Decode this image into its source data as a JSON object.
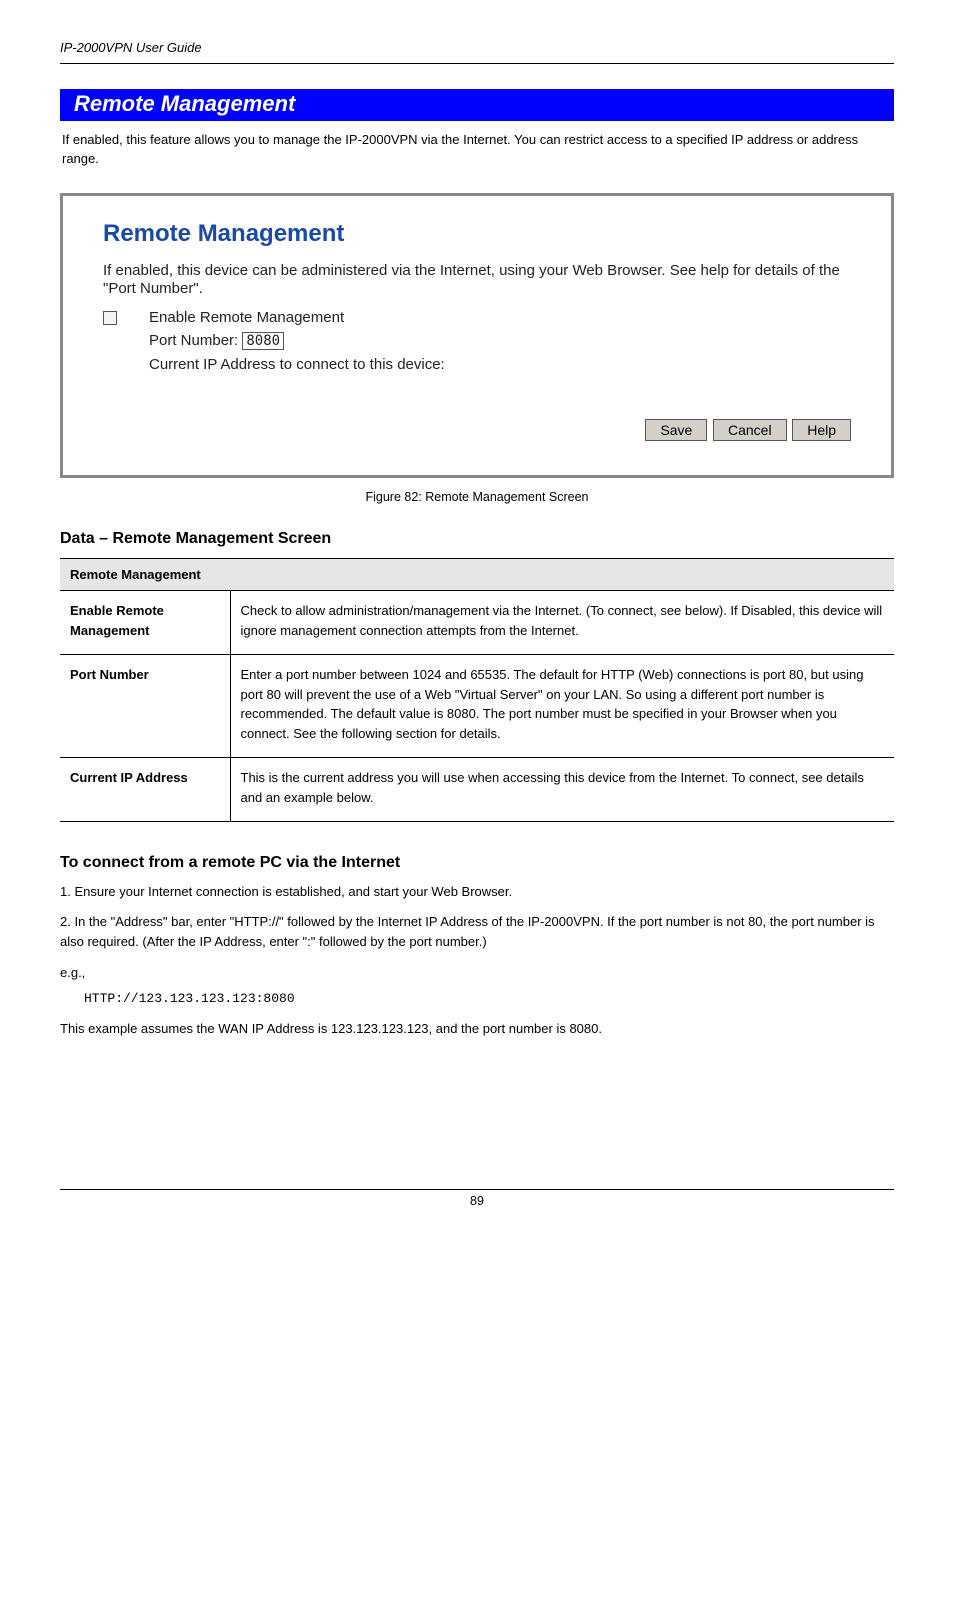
{
  "header": {
    "left": "IP-2000VPN User Guide",
    "right": ""
  },
  "bluebar": {
    "title": "Remote Management"
  },
  "intro": "If enabled, this feature allows you to manage the IP-2000VPN via the Internet. You can restrict access to a specified IP address or address range.",
  "screenshot": {
    "title": "Remote Management",
    "desc": "If enabled, this device can be administered via the Internet, using your Web Browser. See help for details of the \"Port Number\".",
    "checkbox_label": "Enable Remote Management",
    "port_label": "Port Number:",
    "port_value": "8080",
    "ip_label": "Current IP Address to connect to this device:",
    "buttons": {
      "save": "Save",
      "cancel": "Cancel",
      "help": "Help"
    }
  },
  "caption": "Figure 82: Remote Management Screen",
  "data_heading": "Data – Remote Management Screen",
  "table": {
    "header": "Remote Management",
    "rows": [
      {
        "label": "Enable Remote Management",
        "value": "Check to allow administration/management via the Internet. (To connect, see below). If Disabled, this device will ignore management connection attempts from the Internet."
      },
      {
        "label": "Port Number",
        "value": "Enter a port number between 1024 and 65535. The default for HTTP (Web) connections is port 80, but using port 80 will prevent the use of a Web \"Virtual Server\" on your LAN.  So using a different port number is recommended. The default value is 8080. The port number must be specified in your Browser when you connect. See the following section for details."
      },
      {
        "label": "Current IP Address",
        "value": "This is the current address you will use when accessing this device from the Internet. To connect, see details and an example below."
      }
    ]
  },
  "connect": {
    "heading": "To connect from a remote PC via the Internet",
    "line1": "1. Ensure your Internet connection is established, and start your Web Browser.",
    "line2a": "2. In the \"Address\" bar, enter \"HTTP://\" followed by the Internet IP Address of the IP-2000VPN. If the port number is not 80, the port number is also required.  (After the IP Address, enter \":\" followed by the port number.)",
    "example_lbl": "e.g.,",
    "example_tail": "This example assumes the WAN IP Address is 123.123.123.123, and the port number is 8080.",
    "url": "HTTP://123.123.123.123:8080"
  },
  "footer": {
    "page": "89"
  }
}
